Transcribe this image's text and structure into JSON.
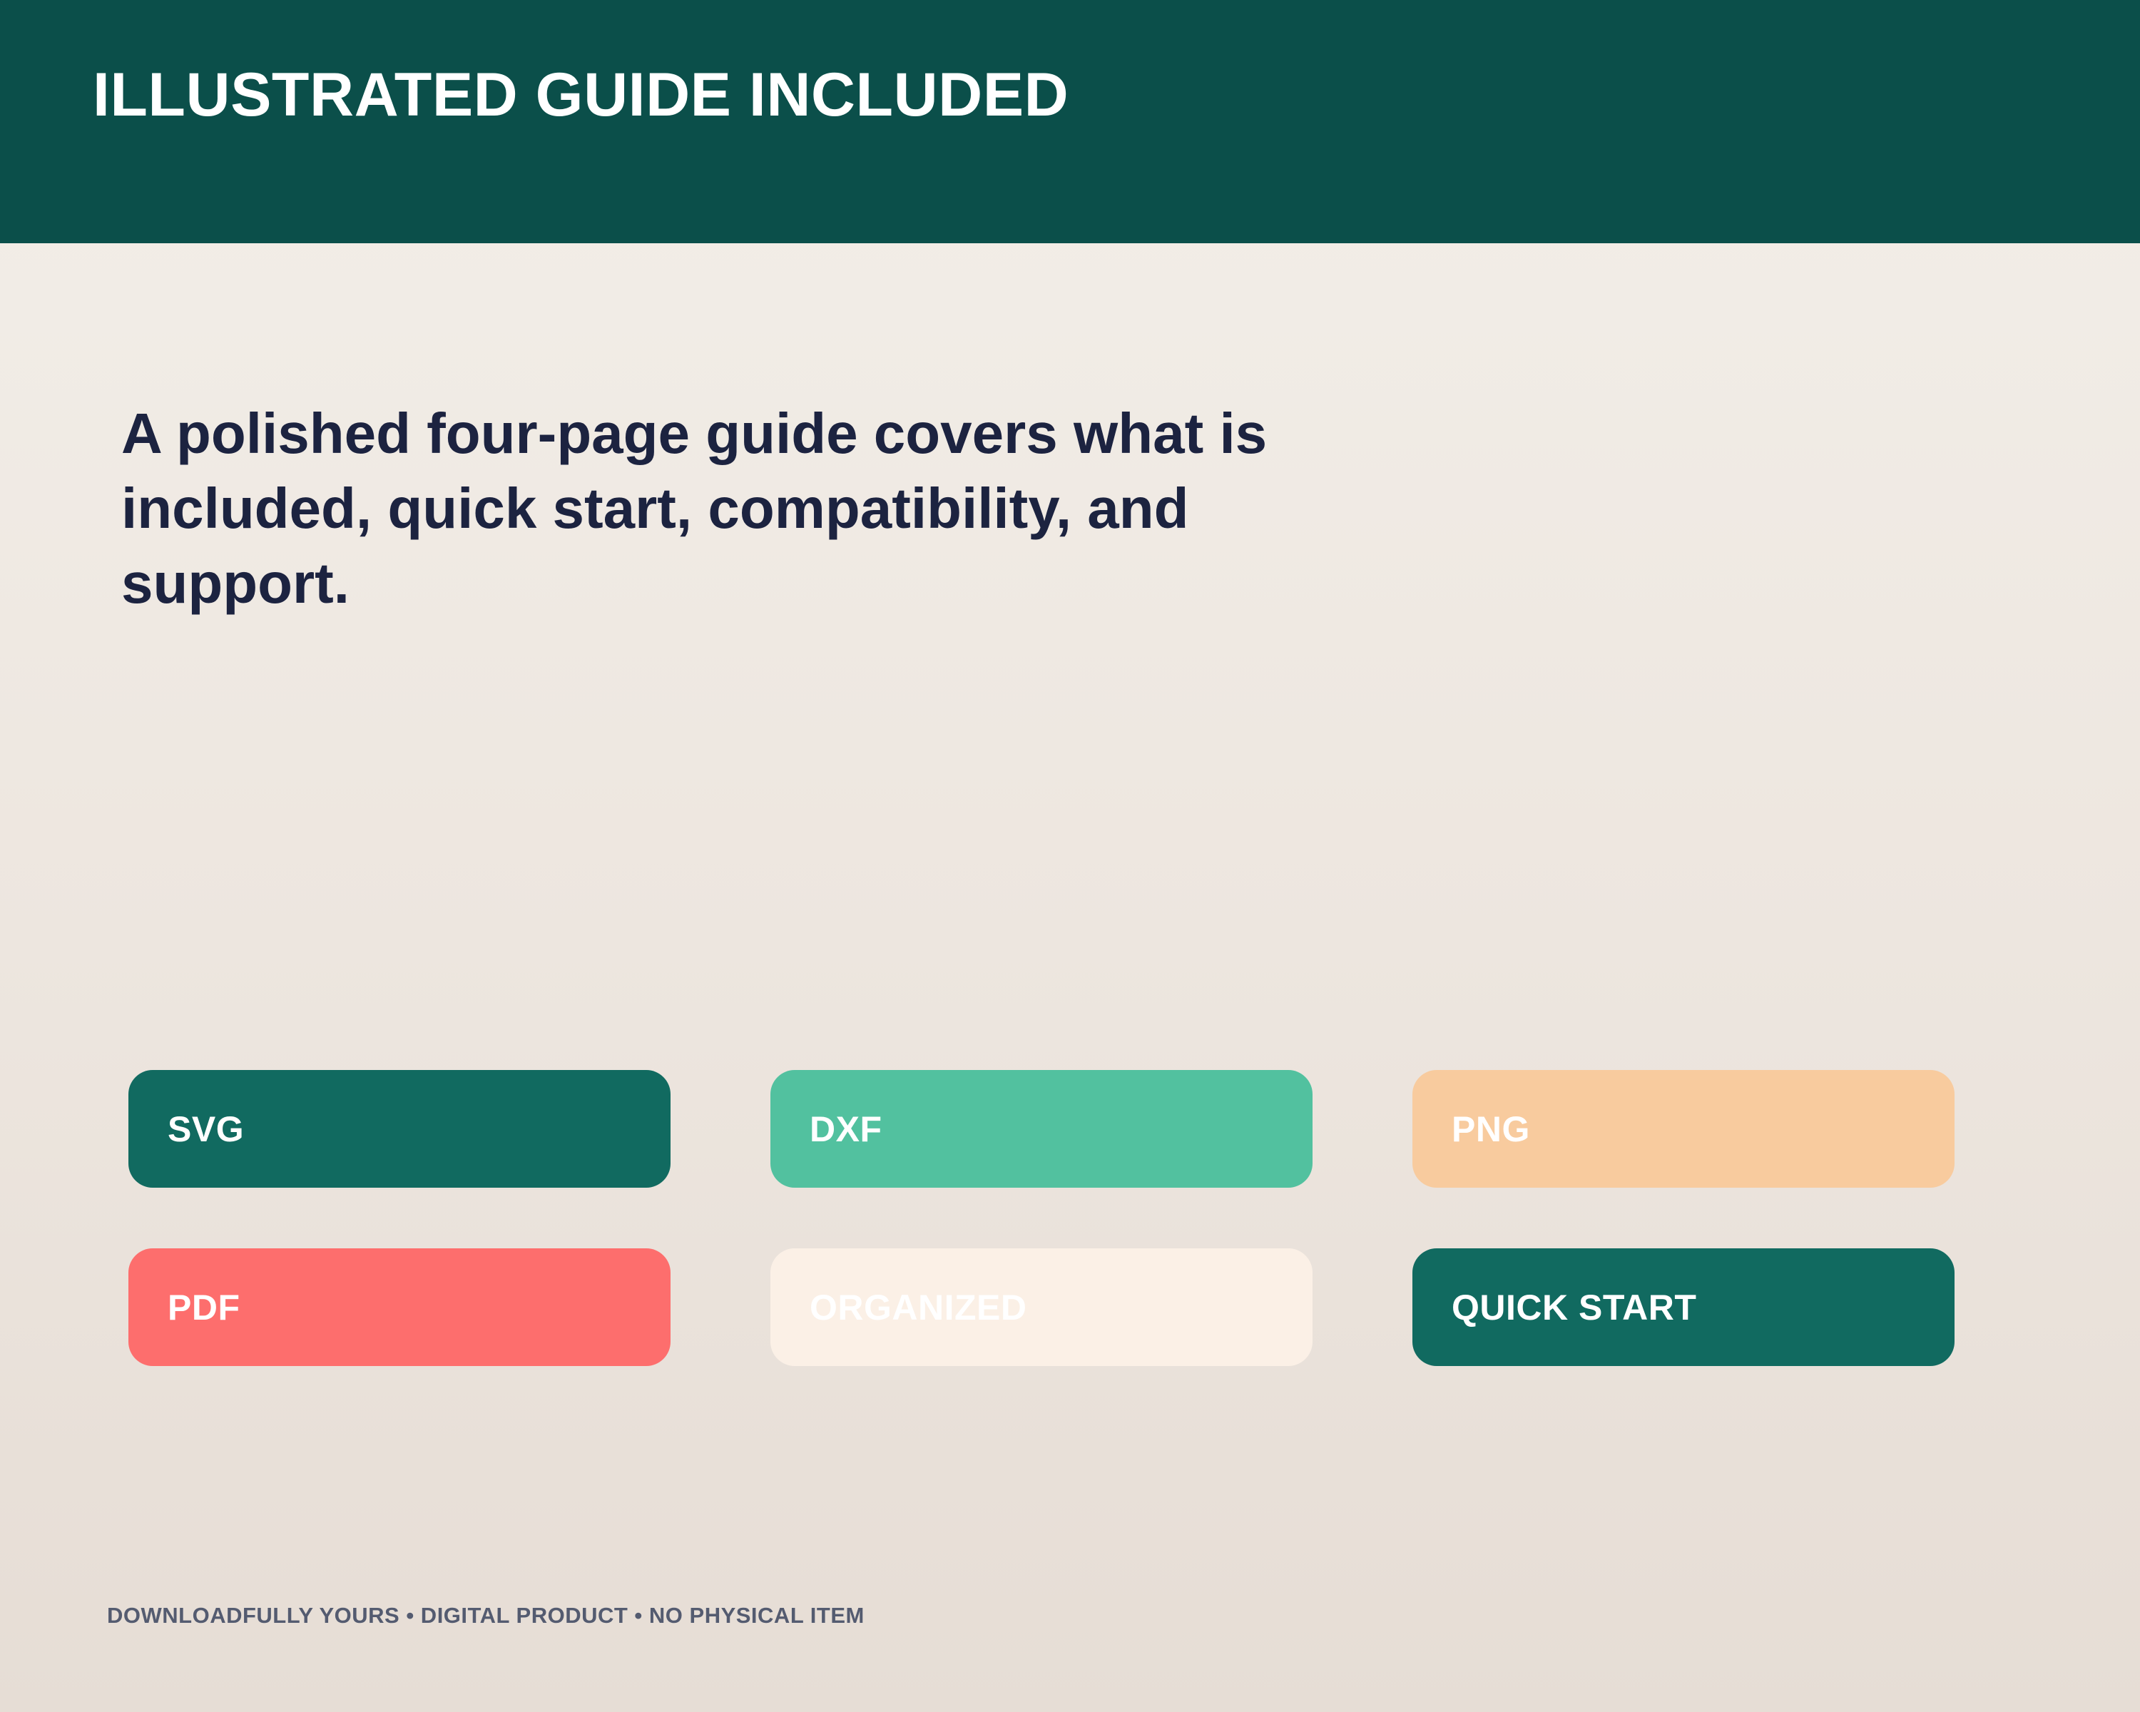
{
  "header": {
    "title": "ILLUSTRATED GUIDE INCLUDED"
  },
  "main": {
    "headline": "A polished four-page guide covers what is included, quick start, compatibility, and support."
  },
  "badges": [
    {
      "label": "SVG",
      "color": "#116a60"
    },
    {
      "label": "DXF",
      "color": "#52c19f"
    },
    {
      "label": "PNG",
      "color": "#f8cb9e"
    },
    {
      "label": "PDF",
      "color": "#fd6e6d"
    },
    {
      "label": "ORGANIZED",
      "color": "#fbf0e6"
    },
    {
      "label": "QUICK START",
      "color": "#116a60"
    }
  ],
  "footer": {
    "text": "DOWNLOADFULLY YOURS • DIGITAL PRODUCT • NO PHYSICAL ITEM"
  },
  "colors": {
    "header_bg": "#0b4f4a",
    "headline_text": "#1c2340",
    "footer_text": "#545b70"
  }
}
